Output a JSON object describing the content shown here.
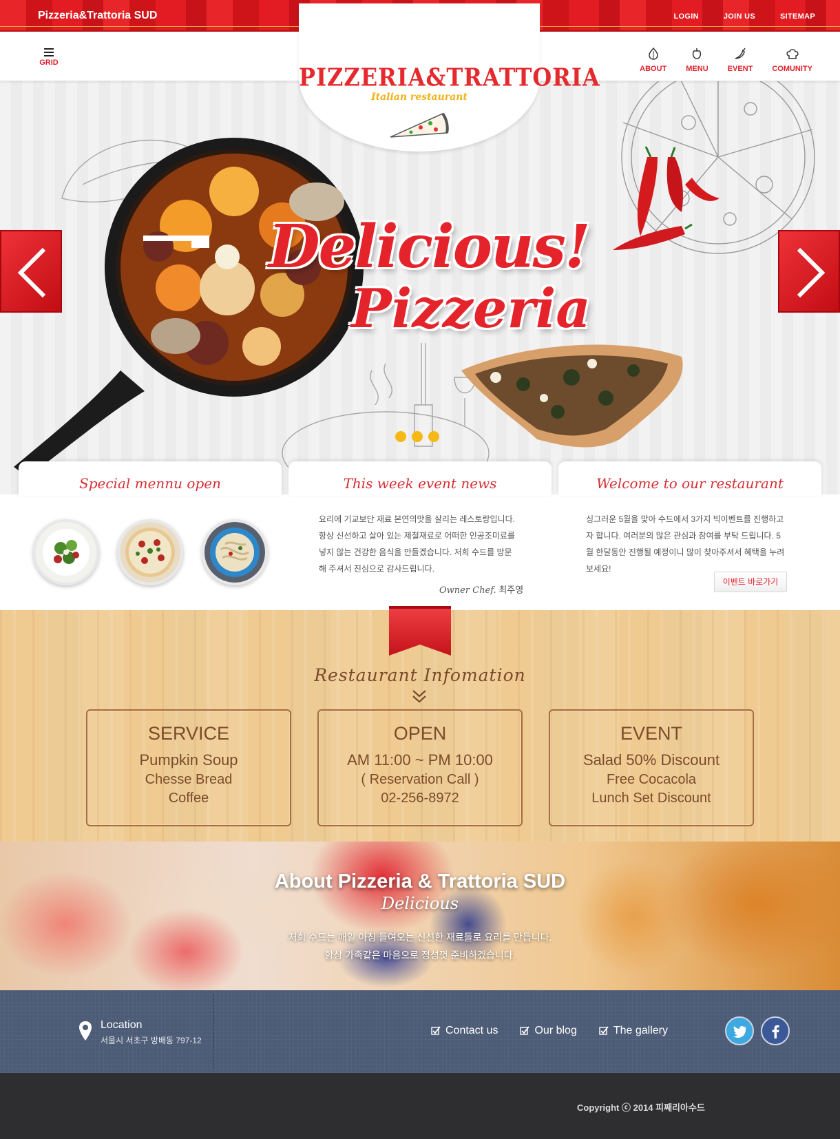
{
  "topbar": {
    "brand": "Pizzeria&Trattoria SUD",
    "links": [
      "LOGIN",
      "JOIN US",
      "SITEMAP"
    ]
  },
  "header": {
    "grid_label": "GRID",
    "logo_title": "PIZZERIA&TRATTORIA",
    "logo_sub": "Italian restaurant",
    "nav": [
      {
        "label": "ABOUT",
        "icon": "garlic-icon"
      },
      {
        "label": "MENU",
        "icon": "pepper-icon"
      },
      {
        "label": "EVENT",
        "icon": "chili-icon"
      },
      {
        "label": "COMUNITY",
        "icon": "chef-hat-icon"
      }
    ]
  },
  "hero": {
    "headline_1": "Delicious!",
    "headline_2": "Pizzeria",
    "slide_count": 3
  },
  "tabs": {
    "special": "Special mennu open",
    "event_news": "This week event news",
    "welcome": "Welcome to our restaurant"
  },
  "content": {
    "menu_thumbs": [
      "salad",
      "pizza",
      "pasta"
    ],
    "event_text_lines": [
      "요리에 기교보단 재료 본연의맛을 살리는 레스토랑입니다.",
      "항상 신선하고 살아 있는 제철재료로 어떠한 인공조미료를",
      "넣지 않는 건강한 음식을 만들겠습니다. 저희 수드를 방문",
      "해 주셔서 진심으로 감사드립니다."
    ],
    "chef_title": "Owner Chef.",
    "chef_name": "최주영",
    "welcome_text_lines": [
      "싱그러운 5월을 맞아 수드에서 3가지 빅이벤트를 진행하고",
      "자 합니다. 여러분의 많은 관심과 참여를 부탁 드립니다. 5",
      "월 한달동안 진행될 예정이니 많이 찾아주셔서 혜택을 누려",
      "보세요!"
    ],
    "event_button": "이벤트 바로가기"
  },
  "info": {
    "title": "Restaurant Infomation",
    "boxes": [
      {
        "title": "SERVICE",
        "l1": "Pumpkin Soup",
        "l2": "Chesse Bread",
        "l3": "Coffee"
      },
      {
        "title": "OPEN",
        "l1": "AM 11:00 ~ PM 10:00",
        "l2": "( Reservation Call )",
        "l3": "02-256-8972"
      },
      {
        "title": "EVENT",
        "l1": "Salad 50% Discount",
        "l2": "Free Cocacola",
        "l3": "Lunch Set Discount"
      }
    ]
  },
  "about": {
    "title": "About Pizzeria & Trattoria SUD",
    "script": "Delicious",
    "line1": "저희 수드는 매일 아침 들여오는 신선한 재료들로 요리를 만듭니다.",
    "line2": "항상 가족같은 마음으로 정성껏 준비하겠습니다."
  },
  "footer": {
    "location_title": "Location",
    "location_addr": "서울시 서초구 방배동 797-12",
    "links": [
      "Contact us",
      "Our blog",
      "The gallery"
    ],
    "social": [
      "twitter-icon",
      "facebook-icon"
    ],
    "copyright": "Copyright ⓒ 2014 피째리아수드"
  },
  "colors": {
    "brand_red": "#e0212b",
    "accent_yellow": "#f5b814",
    "wood_text": "#7b4c2b",
    "footer_blue": "#4c5b76",
    "footer_dark": "#2e2e30"
  }
}
